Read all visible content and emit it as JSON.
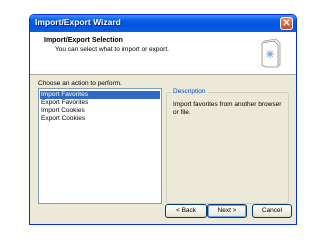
{
  "window": {
    "title": "Import/Export Wizard",
    "close_glyph": "✕"
  },
  "header": {
    "title": "Import/Export Selection",
    "subtitle": "You can select what to import or export.",
    "icon": "wizard-page-icon"
  },
  "actions": {
    "label": "Choose an action to perform.",
    "items": [
      {
        "label": "Import Favorites",
        "selected": true
      },
      {
        "label": "Export Favorites",
        "selected": false
      },
      {
        "label": "Import Cookies",
        "selected": false
      },
      {
        "label": "Export Cookies",
        "selected": false
      }
    ]
  },
  "description": {
    "legend": "Description",
    "text": "Import favorites from another browser or file."
  },
  "buttons": {
    "back": "< Back",
    "next": "Next >",
    "cancel": "Cancel"
  },
  "colors": {
    "titlebar": "#0054e3",
    "dialog_bg": "#ece9d8",
    "selection": "#316ac5",
    "legend_text": "#0046d5"
  }
}
